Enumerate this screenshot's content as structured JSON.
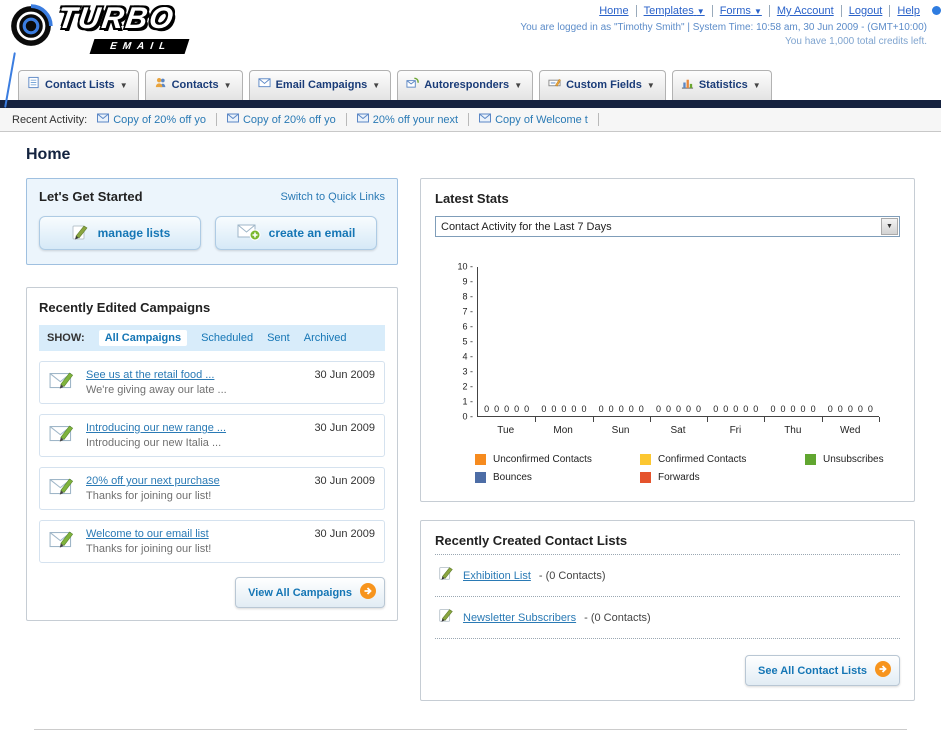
{
  "header": {
    "logo_text": "TURBO",
    "logo_sub": "EMAIL",
    "links": [
      "Home",
      "Templates",
      "Forms",
      "My Account",
      "Logout",
      "Help"
    ],
    "login_info": "You are logged in as \"Timothy Smith\" | System Time: 10:58 am, 30 Jun 2009 - (GMT+10:00)",
    "credits_info": "You have 1,000 total credits left."
  },
  "nav": {
    "tabs": [
      {
        "label": "Contact Lists"
      },
      {
        "label": "Contacts"
      },
      {
        "label": "Email Campaigns"
      },
      {
        "label": "Autoresponders"
      },
      {
        "label": "Custom Fields"
      },
      {
        "label": "Statistics"
      }
    ]
  },
  "recent_activity": {
    "label": "Recent Activity:",
    "items": [
      "Copy of 20% off yo",
      "Copy of 20% off yo",
      "20% off your next",
      "Copy of Welcome t"
    ]
  },
  "page": {
    "title": "Home"
  },
  "get_started": {
    "title": "Let's Get Started",
    "switch_link": "Switch to Quick Links",
    "manage_lists_label": "manage lists",
    "create_email_label": "create an email"
  },
  "campaigns": {
    "title": "Recently Edited Campaigns",
    "show_label": "SHOW:",
    "filters": [
      "All Campaigns",
      "Scheduled",
      "Sent",
      "Archived"
    ],
    "active_filter": "All Campaigns",
    "items": [
      {
        "title": "See us at the retail food ...",
        "subtitle": "We're giving away our late ...",
        "date": "30 Jun 2009"
      },
      {
        "title": "Introducing our new range ...",
        "subtitle": "Introducing our new Italia ...",
        "date": "30 Jun 2009"
      },
      {
        "title": "20% off your next purchase",
        "subtitle": "Thanks for joining our list!",
        "date": "30 Jun 2009"
      },
      {
        "title": "Welcome to our email list",
        "subtitle": "Thanks for joining our list!",
        "date": "30 Jun 2009"
      }
    ],
    "view_all_label": "View All Campaigns"
  },
  "stats": {
    "title": "Latest Stats",
    "period_selector": "Contact Activity for the Last 7 Days"
  },
  "chart_data": {
    "type": "bar",
    "title": "Contact Activity for the Last 7 Days",
    "categories": [
      "Tue",
      "Mon",
      "Sun",
      "Sat",
      "Fri",
      "Thu",
      "Wed"
    ],
    "series": [
      {
        "name": "Unconfirmed Contacts",
        "color": "#f68b1f",
        "values": [
          0,
          0,
          0,
          0,
          0,
          0,
          0
        ]
      },
      {
        "name": "Confirmed Contacts",
        "color": "#fcc731",
        "values": [
          0,
          0,
          0,
          0,
          0,
          0,
          0
        ]
      },
      {
        "name": "Unsubscribes",
        "color": "#61a630",
        "values": [
          0,
          0,
          0,
          0,
          0,
          0,
          0
        ]
      },
      {
        "name": "Bounces",
        "color": "#4d6da6",
        "values": [
          0,
          0,
          0,
          0,
          0,
          0,
          0
        ]
      },
      {
        "name": "Forwards",
        "color": "#e5532c",
        "values": [
          0,
          0,
          0,
          0,
          0,
          0,
          0
        ]
      }
    ],
    "ylim": [
      0,
      10
    ],
    "yticks": [
      0,
      1,
      2,
      3,
      4,
      5,
      6,
      7,
      8,
      9,
      10
    ],
    "grid": false,
    "legend_position": "bottom"
  },
  "contact_lists": {
    "title": "Recently Created Contact Lists",
    "items": [
      {
        "name": "Exhibition List",
        "detail": "- (0 Contacts)"
      },
      {
        "name": "Newsletter Subscribers",
        "detail": "- (0 Contacts)"
      }
    ],
    "see_all_label": "See All Contact Lists"
  }
}
